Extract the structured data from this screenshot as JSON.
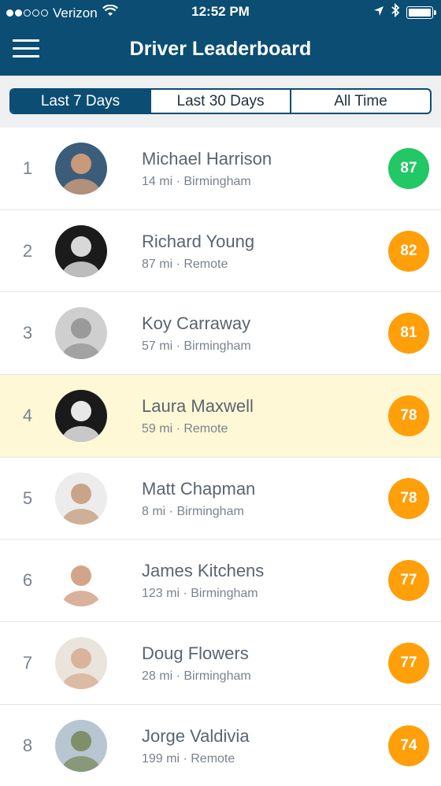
{
  "status_bar": {
    "carrier": "Verizon",
    "time": "12:52 PM",
    "signal_bars_filled": 2,
    "signal_bars_total": 5
  },
  "nav": {
    "title": "Driver Leaderboard",
    "menu_icon": "hamburger-menu-icon"
  },
  "tabs": [
    {
      "label": "Last 7 Days",
      "active": true
    },
    {
      "label": "Last 30 Days",
      "active": false
    },
    {
      "label": "All Time",
      "active": false
    }
  ],
  "colors": {
    "header": "#0b4d73",
    "score_green": "#22c766",
    "score_orange": "#ff9f0a",
    "highlight_row": "#fff8d6"
  },
  "drivers": [
    {
      "rank": "1",
      "name": "Michael Harrison",
      "meta": "14 mi · Birmingham",
      "score": "87",
      "score_color": "#22c766",
      "highlight": false,
      "avatar_tone": "#c79a7a",
      "avatar_bg": "#3b5d7a"
    },
    {
      "rank": "2",
      "name": "Richard Young",
      "meta": "87 mi · Remote",
      "score": "82",
      "score_color": "#ff9f0a",
      "highlight": false,
      "avatar_tone": "#d8d8d8",
      "avatar_bg": "#1b1b1b"
    },
    {
      "rank": "3",
      "name": "Koy Carraway",
      "meta": "57 mi · Birmingham",
      "score": "81",
      "score_color": "#ff9f0a",
      "highlight": false,
      "avatar_tone": "#9a9a9a",
      "avatar_bg": "#cfcfcf"
    },
    {
      "rank": "4",
      "name": "Laura Maxwell",
      "meta": "59 mi · Remote",
      "score": "78",
      "score_color": "#ff9f0a",
      "highlight": true,
      "avatar_tone": "#e8e8e8",
      "avatar_bg": "#1a1a1a"
    },
    {
      "rank": "5",
      "name": "Matt Chapman",
      "meta": "8 mi · Birmingham",
      "score": "78",
      "score_color": "#ff9f0a",
      "highlight": false,
      "avatar_tone": "#c9a48a",
      "avatar_bg": "#ececec"
    },
    {
      "rank": "6",
      "name": "James Kitchens",
      "meta": "123 mi · Birmingham",
      "score": "77",
      "score_color": "#ff9f0a",
      "highlight": false,
      "avatar_tone": "#d2a58a",
      "avatar_bg": "#ffffff"
    },
    {
      "rank": "7",
      "name": "Doug Flowers",
      "meta": "28 mi · Birmingham",
      "score": "77",
      "score_color": "#ff9f0a",
      "highlight": false,
      "avatar_tone": "#d9b39a",
      "avatar_bg": "#e9e4dc"
    },
    {
      "rank": "8",
      "name": "Jorge Valdivia",
      "meta": "199 mi · Remote",
      "score": "74",
      "score_color": "#ff9f0a",
      "highlight": false,
      "avatar_tone": "#7f8f6a",
      "avatar_bg": "#b8c6d2"
    }
  ]
}
